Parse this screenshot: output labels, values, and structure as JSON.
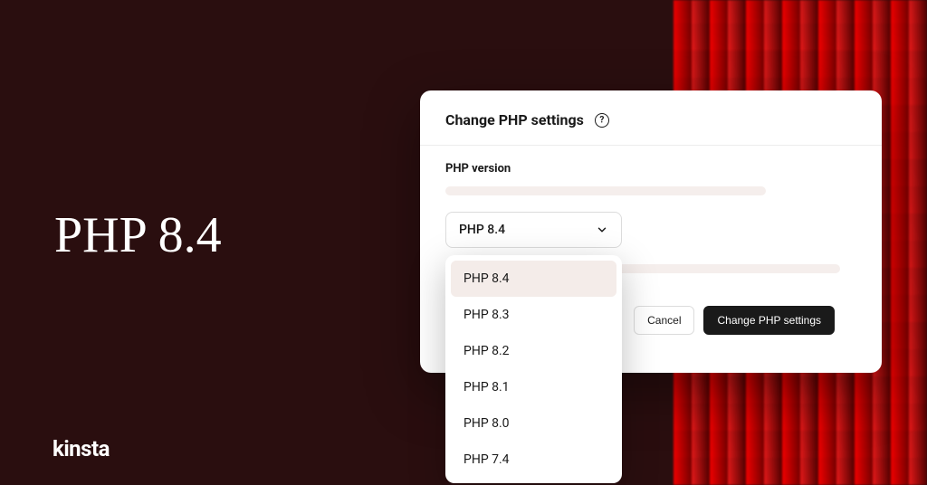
{
  "headline": "PHP 8.4",
  "brand": "kinsta",
  "modal": {
    "title": "Change PHP settings",
    "section_label": "PHP version",
    "selected": "PHP 8.4",
    "options": [
      "PHP 8.4",
      "PHP 8.3",
      "PHP 8.2",
      "PHP 8.1",
      "PHP 8.0",
      "PHP 7.4"
    ],
    "cancel_label": "Cancel",
    "submit_label": "Change PHP settings"
  }
}
